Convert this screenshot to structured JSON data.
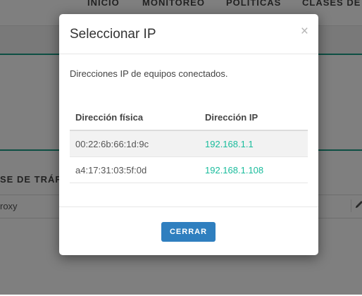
{
  "background": {
    "nav": [
      "INICIO",
      "MONITOREO",
      "POLÍTICAS",
      "CLASES DE"
    ],
    "section_title": "SE DE TRÁF",
    "row_text": "roxy"
  },
  "modal": {
    "title": "Seleccionar IP",
    "close_glyph": "×",
    "description": "Direcciones IP de equipos conectados.",
    "columns": [
      "Dirección física",
      "Dirección IP"
    ],
    "rows": [
      {
        "mac": "00:22:6b:66:1d:9c",
        "ip": "192.168.1.1"
      },
      {
        "mac": "a4:17:31:03:5f:0d",
        "ip": "192.168.1.108"
      }
    ],
    "close_button_label": "CERRAR"
  },
  "colors": {
    "accent": "#1abc9c",
    "primary_button": "#2f7fbf",
    "band_border": "#1a9e86"
  },
  "icons": {
    "dismiss": "close-icon",
    "nav_caret": "caret-down-icon",
    "edit": "pencil-icon"
  }
}
